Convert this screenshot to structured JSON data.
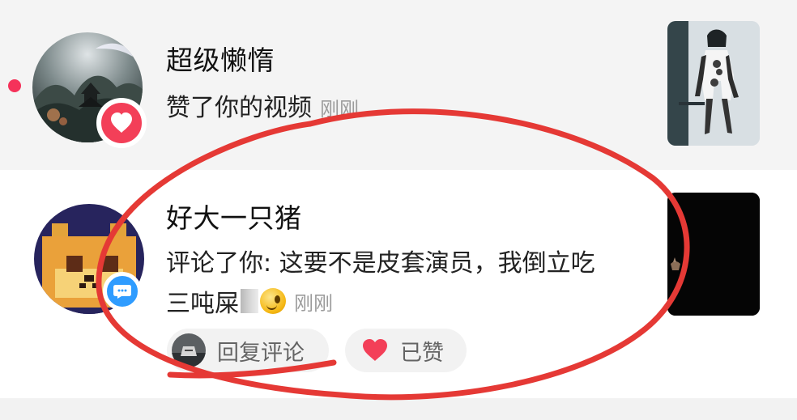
{
  "notifications": [
    {
      "username": "超级懒惰",
      "action": "赞了你的视频",
      "time": "刚刚"
    },
    {
      "username": "好大一只猪",
      "comment_line1": "评论了你: 这要不是皮套演员，我倒立吃",
      "comment_line2": "三吨屎",
      "time": "刚刚",
      "reply_button": "回复评论",
      "liked_button": "已赞"
    }
  ],
  "icons": {
    "like_badge": "heart-icon",
    "comment_badge": "speech-bubble-icon",
    "liked": "heart-icon"
  },
  "colors": {
    "accent": "#f33f58",
    "comment_badge": "#2f9cff",
    "annotation": "#e53935"
  }
}
